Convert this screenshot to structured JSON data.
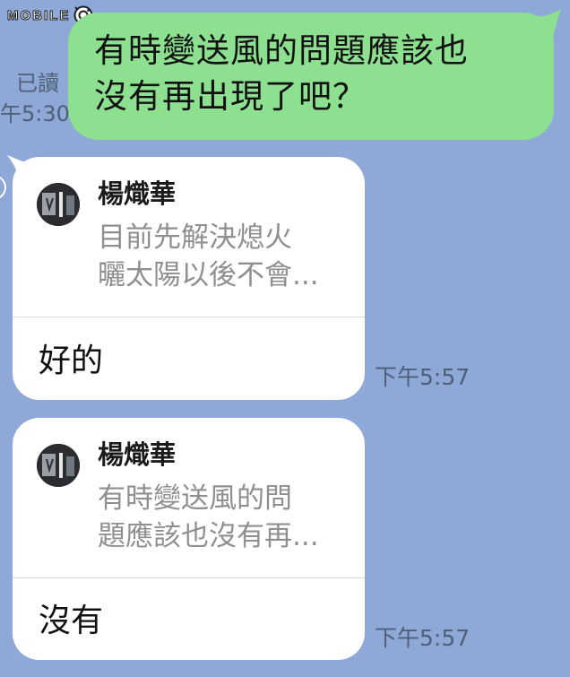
{
  "watermark": {
    "text": "MOBILE",
    "icon": "camera-icon"
  },
  "messages": {
    "outgoing": {
      "lines": [
        "有時變送風的問題應該也",
        "沒有再出現了吧？"
      ],
      "read_status": "已讀",
      "time": "午5:30"
    },
    "replies": [
      {
        "sender": "楊熾華",
        "quoted_preview_lines": [
          "目前先解決熄火",
          "曬太陽以後不會..."
        ],
        "message": "好的",
        "time": "下午5:57"
      },
      {
        "sender": "楊熾華",
        "quoted_preview_lines": [
          "有時變送風的問",
          "題應該也沒有再..."
        ],
        "message": "沒有",
        "time": "下午5:57"
      }
    ]
  },
  "colors": {
    "background": "#8ea9d8",
    "outgoing_bubble": "#8de08f",
    "incoming_bubble": "#ffffff",
    "meta_text": "#4f5f75",
    "preview_text": "#8f8f8f"
  }
}
